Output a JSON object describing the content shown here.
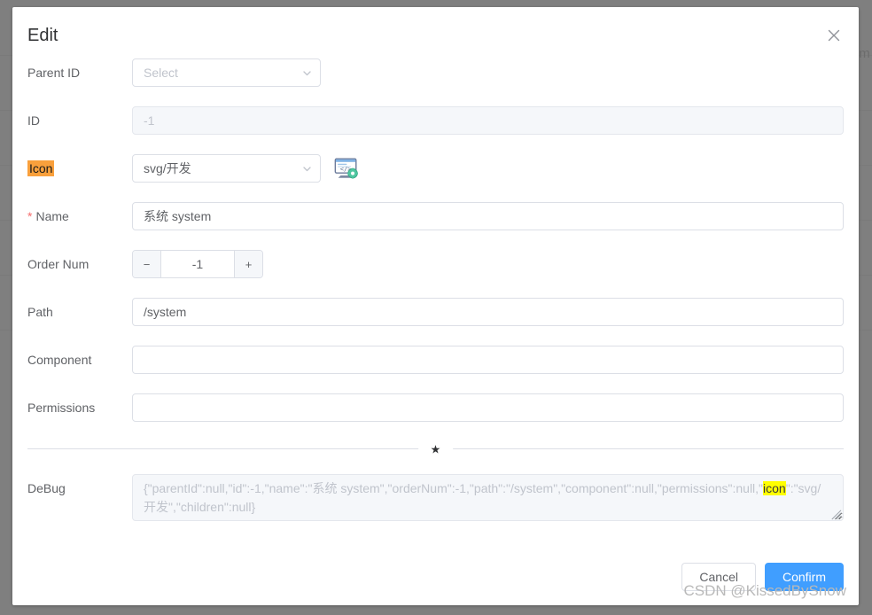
{
  "dialog": {
    "title": "Edit",
    "close_icon": "close-icon"
  },
  "form": {
    "parent_id": {
      "label": "Parent ID",
      "placeholder": "Select",
      "value": "",
      "chevron_icon": "chevron-down-icon"
    },
    "id": {
      "label": "ID",
      "value": "-1",
      "disabled": true
    },
    "icon": {
      "label": "Icon",
      "highlighted": true,
      "highlight_color": "#f9a03c",
      "value": "svg/开发",
      "chevron_icon": "chevron-down-icon",
      "preview_icon": "development-monitor-icon"
    },
    "name": {
      "label": "Name",
      "required": true,
      "required_marker": "*",
      "value": "系统 system"
    },
    "order_num": {
      "label": "Order Num",
      "value": "-1",
      "decrement_label": "−",
      "increment_label": "+"
    },
    "path": {
      "label": "Path",
      "value": "/system"
    },
    "component": {
      "label": "Component",
      "value": ""
    },
    "permissions": {
      "label": "Permissions",
      "value": ""
    },
    "divider": {
      "mark": "★"
    },
    "debug": {
      "label": "DeBug",
      "value_before": "{\"parentId\":null,\"id\":-1,\"name\":\"系统 system\",\"orderNum\":-1,\"path\":\"/system\",\"component\":null,\"permissions\":null,\"",
      "value_highlight": "icon",
      "value_after": "\":\"svg/开发\",\"children\":null}",
      "full_value": "{\"parentId\":null,\"id\":-1,\"name\":\"系统 system\",\"orderNum\":-1,\"path\":\"/system\",\"component\":null,\"permissions\":null,\"icon\":\"svg/开发\",\"children\":null}",
      "highlight_color": "#ffff00"
    }
  },
  "footer": {
    "cancel_label": "Cancel",
    "confirm_label": "Confirm",
    "confirm_color": "#409eff"
  },
  "watermark": {
    "text": "CSDN @KissedBySnow"
  },
  "background": {
    "edge_text": "m"
  }
}
